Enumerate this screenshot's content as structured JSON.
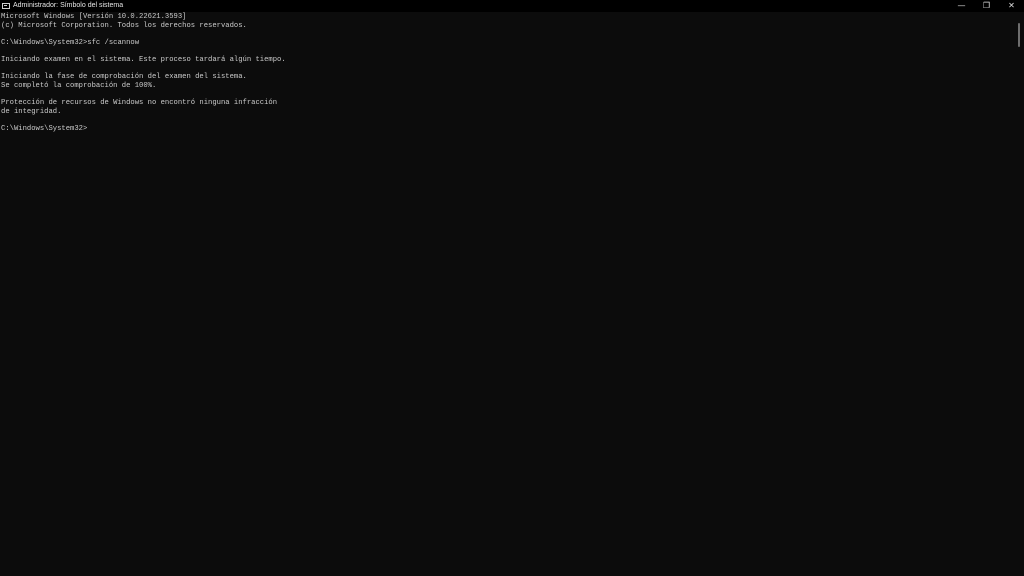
{
  "window": {
    "title": "Administrador: Símbolo del sistema",
    "icon": "cmd-icon",
    "controls": {
      "minimize": "—",
      "restore": "❐",
      "close": "✕"
    }
  },
  "console": {
    "lines": [
      "Microsoft Windows [Versión 10.0.22621.3593]",
      "(c) Microsoft Corporation. Todos los derechos reservados.",
      "",
      "C:\\Windows\\System32>sfc /scannow",
      "",
      "Iniciando examen en el sistema. Este proceso tardará algún tiempo.",
      "",
      "Iniciando la fase de comprobación del examen del sistema.",
      "Se completó la comprobación de 100%.",
      "",
      "Protección de recursos de Windows no encontró ninguna infracción",
      "de integridad.",
      "",
      "C:\\Windows\\System32>"
    ]
  }
}
